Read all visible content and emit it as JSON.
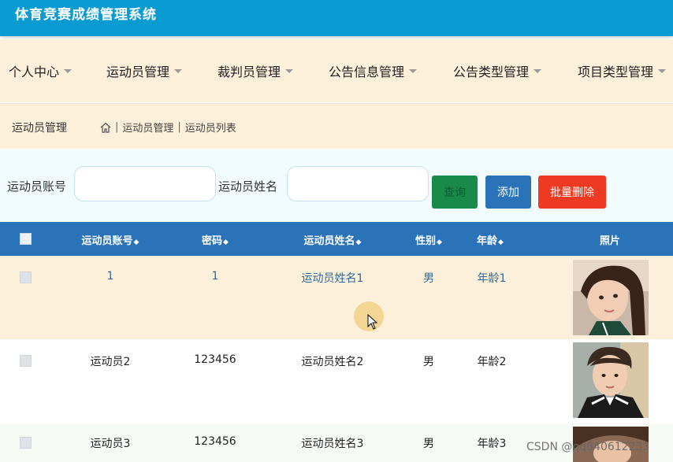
{
  "app": {
    "title": "体育竞赛成绩管理系统"
  },
  "nav": {
    "items": [
      {
        "label": "个人中心"
      },
      {
        "label": "运动员管理"
      },
      {
        "label": "裁判员管理"
      },
      {
        "label": "公告信息管理"
      },
      {
        "label": "公告类型管理"
      },
      {
        "label": "项目类型管理"
      }
    ]
  },
  "breadcrumb": {
    "title": "运动员管理",
    "crumbs": [
      "运动员管理",
      "运动员列表"
    ]
  },
  "search": {
    "account_label": "运动员账号",
    "name_label": "运动员姓名",
    "account_value": "",
    "name_value": "",
    "search_btn": "查询",
    "add_btn": "添加",
    "batch_delete_btn": "批量删除"
  },
  "table": {
    "headers": [
      "运动员账号",
      "密码",
      "运动员姓名",
      "性别",
      "年龄",
      "照片"
    ],
    "rows": [
      {
        "account": "1",
        "password": "1",
        "name": "运动员姓名1",
        "gender": "男",
        "age": "年龄1",
        "photo": "photo-1"
      },
      {
        "account": "运动员2",
        "password": "123456",
        "name": "运动员姓名2",
        "gender": "男",
        "age": "年龄2",
        "photo": "photo-2"
      },
      {
        "account": "运动员3",
        "password": "123456",
        "name": "运动员姓名3",
        "gender": "男",
        "age": "年龄3",
        "photo": "photo-3"
      }
    ]
  },
  "watermark": "CSDN @qq840612233",
  "colors": {
    "header": "#0b9bd3",
    "nav_bg": "#fdf0da",
    "table_header": "#2b73b8",
    "search_btn": "#1a8a4a",
    "add_btn": "#2b73b8",
    "delete_btn": "#ef3a23"
  }
}
